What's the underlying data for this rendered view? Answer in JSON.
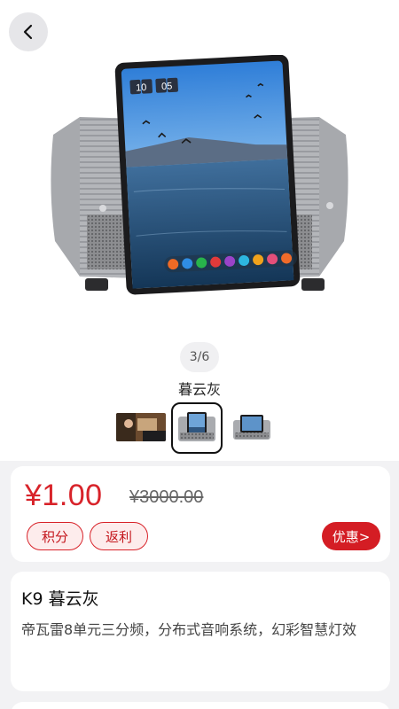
{
  "gallery": {
    "pager": "3/6",
    "color_name": "暮云灰",
    "clock_digits": [
      "10",
      "05"
    ],
    "thumbnails": [
      "thumb-scene",
      "thumb-speaker-selected",
      "thumb-speaker"
    ]
  },
  "price": {
    "current": "¥1.00",
    "original": "¥3000.00",
    "tags": [
      "积分",
      "返利"
    ],
    "promo_label": "优惠>"
  },
  "product": {
    "title": "K9 暮云灰",
    "description": "帝瓦雷8单元三分频，分布式音响系统，幻彩智慧灯效"
  },
  "colors": {
    "accent": "#d8232a",
    "background": "#f2f2f4"
  },
  "icons": {
    "back": "chevron-left-icon"
  }
}
